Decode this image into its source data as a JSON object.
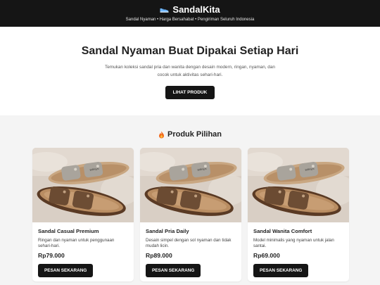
{
  "header": {
    "brand_icon": "sneaker-icon",
    "brand": "SandalKita",
    "tagline": "Sandal Nyaman • Harga Bersahabat • Pengiriman Seluruh Indonesia"
  },
  "hero": {
    "title": "Sandal Nyaman Buat Dipakai Setiap Hari",
    "description": "Temukan koleksi sandal pria dan wanita dengan desain modern, ringan, nyaman, dan cocok untuk aktivitas sehari-hari.",
    "cta_label": "LIHAT PRODUK"
  },
  "products": {
    "section_icon": "fire-icon",
    "title": "Produk Pilihan",
    "items": [
      {
        "name": "Sandal Casual Premium",
        "description": "Ringan dan nyaman untuk penggunaan sehari-hari.",
        "price": "Rp79.000",
        "button_label": "PESAN SEKARANG"
      },
      {
        "name": "Sandal Pria Daily",
        "description": "Desain simpel dengan sol nyaman dan tidak mudah licin.",
        "price": "Rp89.000",
        "button_label": "PESAN SEKARANG"
      },
      {
        "name": "Sandal Wanita Comfort",
        "description": "Model minimalis yang nyaman untuk jalan santai.",
        "price": "Rp69.000",
        "button_label": "PESAN SEKARANG"
      }
    ]
  },
  "colors": {
    "header_bg": "#151515",
    "button_bg": "#151515",
    "page_bg": "#f4f4f4",
    "card_bg": "#ffffff"
  }
}
